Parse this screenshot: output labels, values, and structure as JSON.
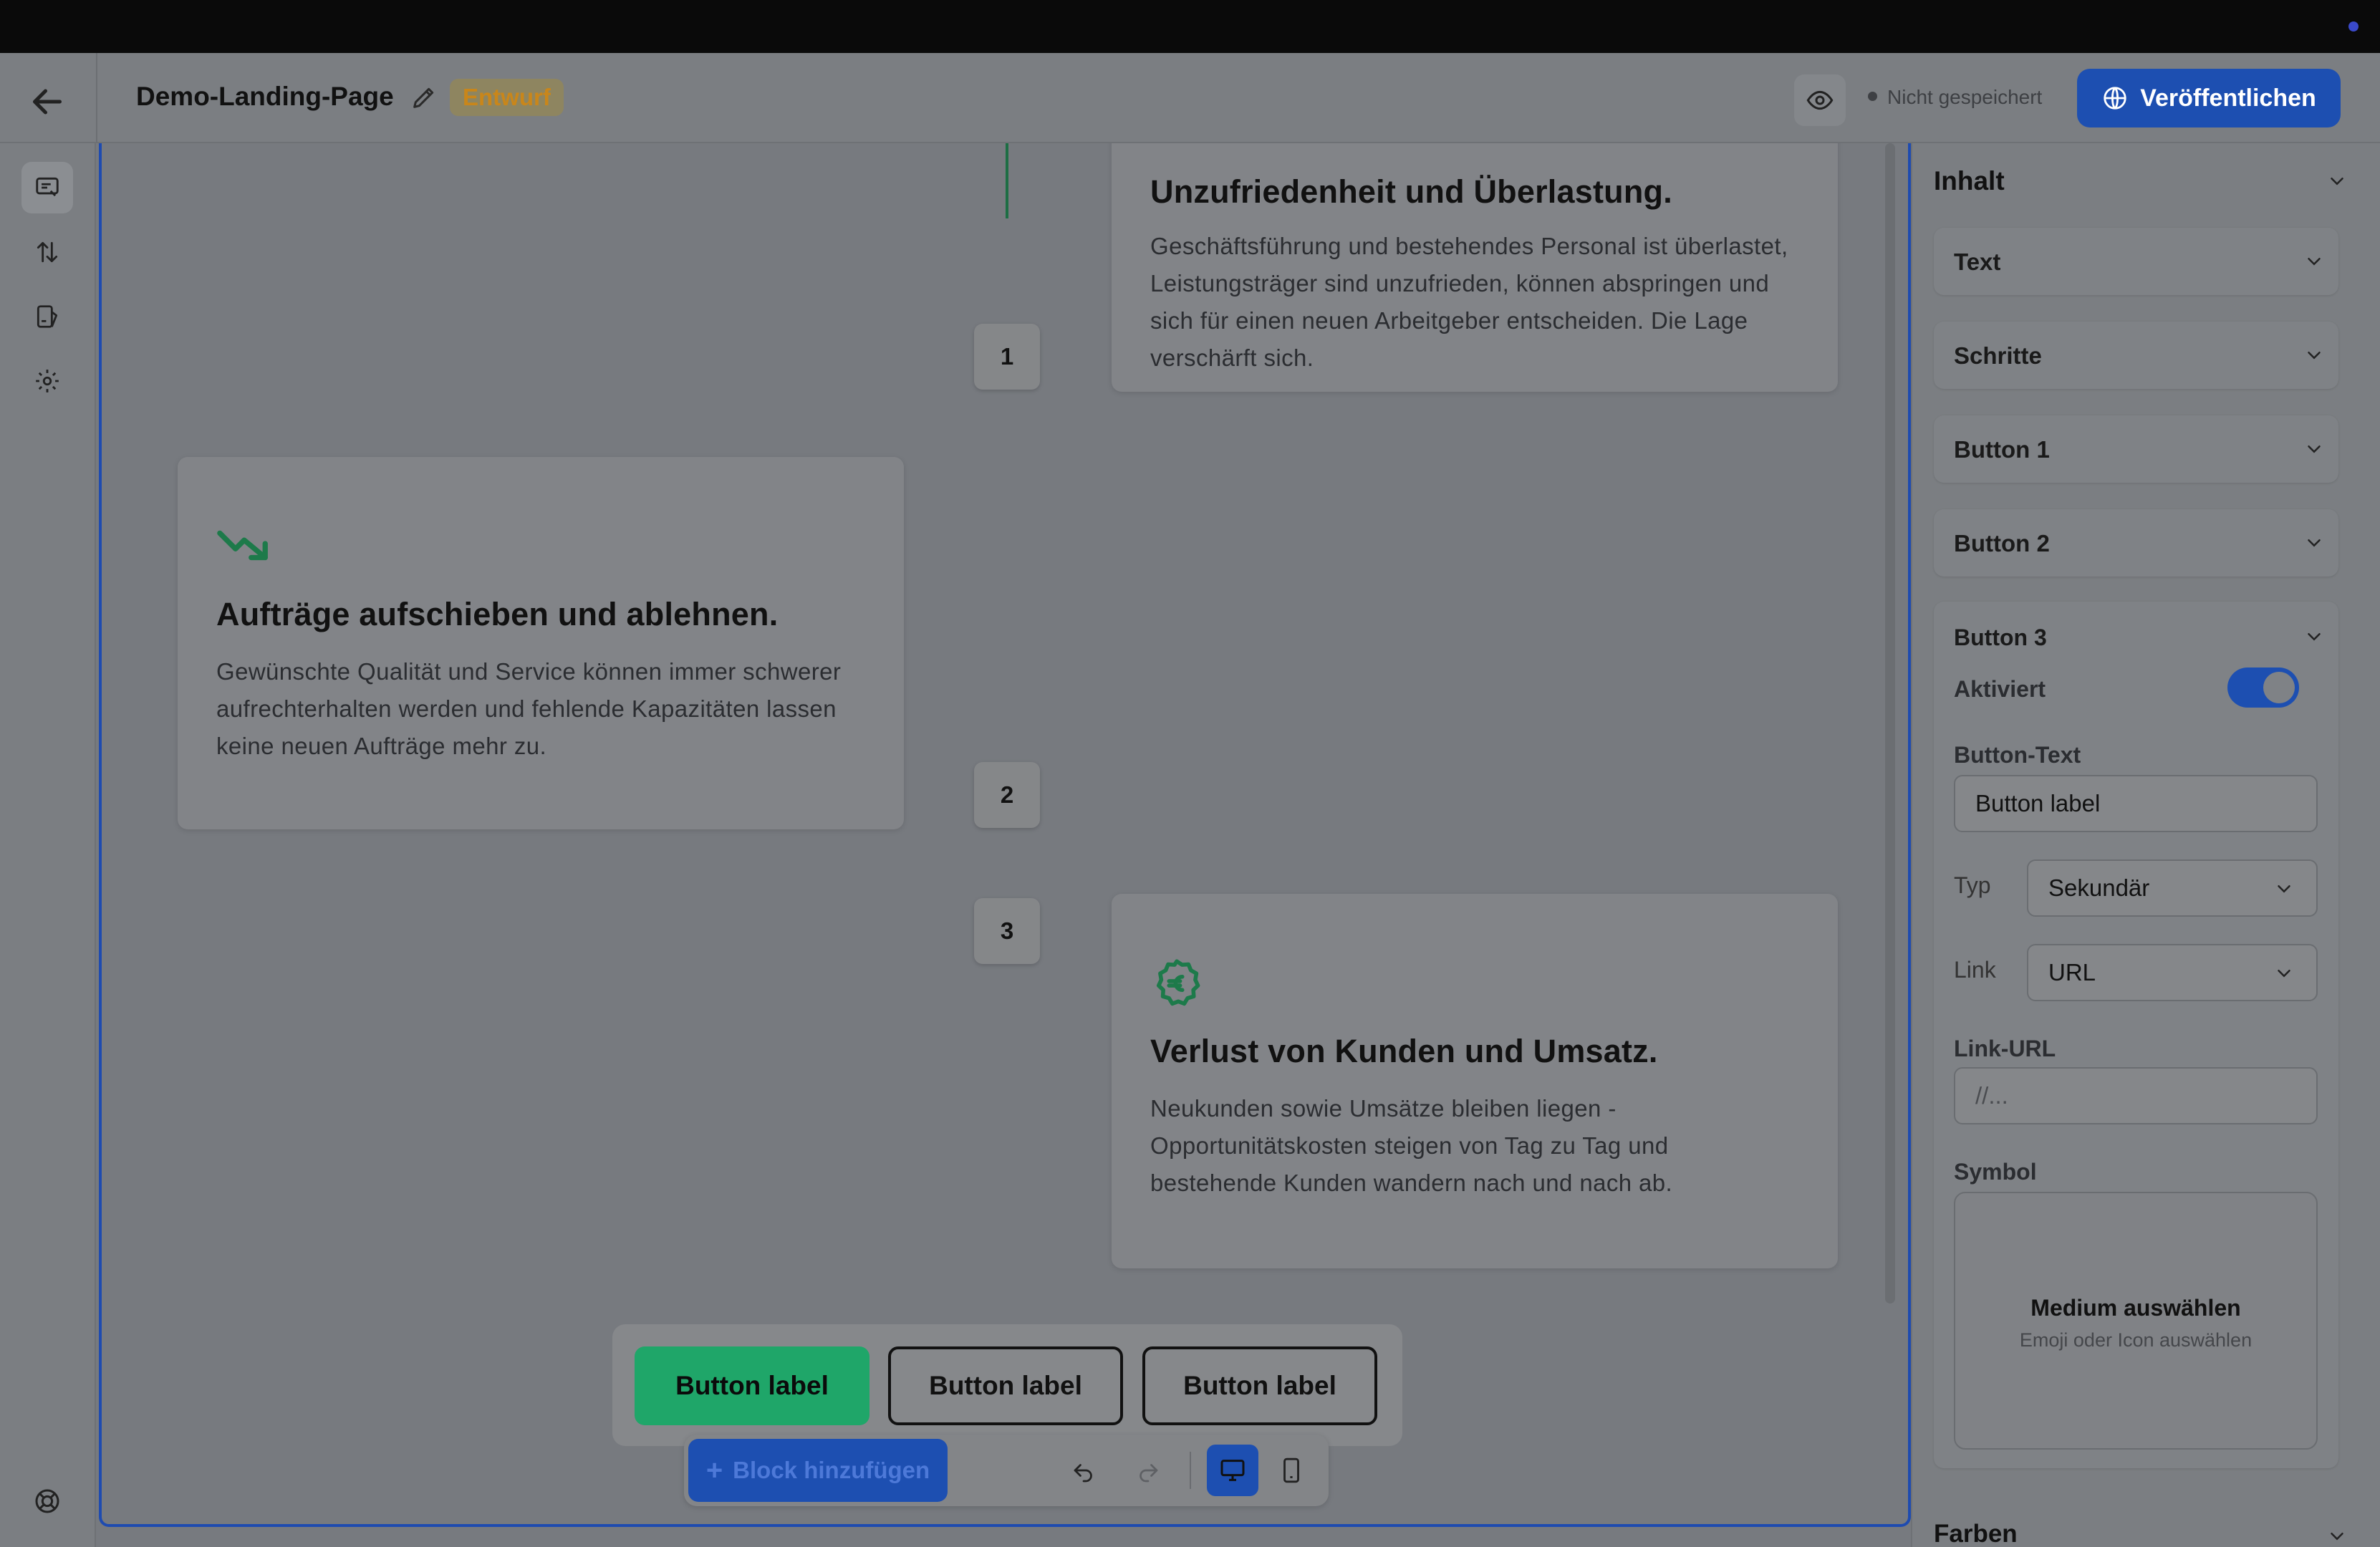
{
  "header": {
    "title": "Demo-Landing-Page",
    "badge": "Entwurf",
    "save_status": "Nicht gespeichert",
    "publish_label": "Veröffentlichen"
  },
  "canvas": {
    "steps": [
      {
        "number": "1",
        "title": "Unzufriedenheit und Überlastung.",
        "text": "Geschäftsführung und bestehendes Personal ist überlastet, Leistungsträger sind unzufrieden, können abspringen und sich für einen neuen Arbeitgeber entscheiden. Die Lage verschärft sich.",
        "icon": "none"
      },
      {
        "number": "2",
        "title": "Aufträge aufschieben und ablehnen.",
        "text": "Gewünschte Qualität und Service können immer schwerer aufrechterhalten werden und fehlende Kapazitäten lassen keine neuen Aufträge mehr zu.",
        "icon": "trend-down-icon"
      },
      {
        "number": "3",
        "title": "Verlust von Kunden und Umsatz.",
        "text": "Neukunden sowie Umsätze bleiben liegen - Opportunitätskosten steigen von Tag zu Tag und bestehende Kunden wandern nach und nach ab.",
        "icon": "euro-badge-icon"
      }
    ],
    "buttons": [
      "Button label",
      "Button label",
      "Button label"
    ],
    "accent_color": "#1fa669"
  },
  "toolbar": {
    "add_block_label": "Block hinzufügen"
  },
  "panel": {
    "heading": "Inhalt",
    "sections": [
      "Text",
      "Schritte",
      "Button 1",
      "Button 2"
    ],
    "open_section": {
      "label": "Button 3",
      "enabled_label": "Aktiviert",
      "enabled": true,
      "button_text_label": "Button-Text",
      "button_text_value": "Button label",
      "type_label": "Typ",
      "type_value": "Sekundär",
      "link_label": "Link",
      "link_value": "URL",
      "link_url_label": "Link-URL",
      "link_url_placeholder": "//...",
      "symbol_label": "Symbol",
      "media_title": "Medium auswählen",
      "media_hint": "Emoji oder Icon auswählen"
    },
    "footer_section": "Farben"
  },
  "colors": {
    "brand_blue": "#1d4fb1",
    "draft_badge": "#c9861a"
  }
}
